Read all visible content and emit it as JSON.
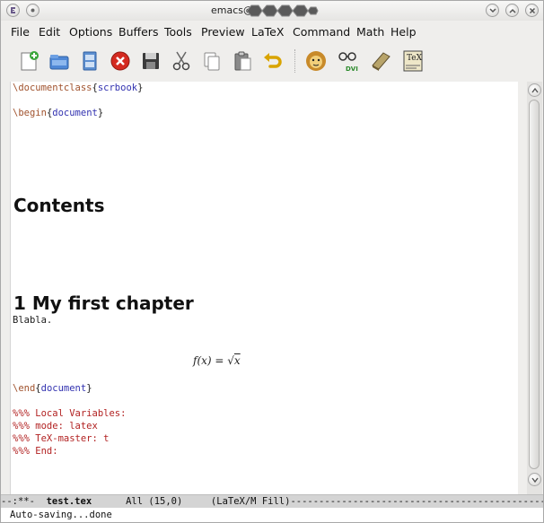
{
  "window": {
    "title": "emacs@"
  },
  "menu": [
    "File",
    "Edit",
    "Options",
    "Buffers",
    "Tools",
    "Preview",
    "LaTeX",
    "Command",
    "Math",
    "Help"
  ],
  "toolbar": {
    "dvi_label": "DVI",
    "tex_label": "TeX"
  },
  "buffer": {
    "line1": {
      "cmd": "\\documentclass",
      "open": "{",
      "arg": "scrbook",
      "close": "}"
    },
    "line2": {
      "cmd": "\\begin",
      "open": "{",
      "arg": "document",
      "close": "}"
    },
    "contents_heading": "Contents",
    "chapter_heading": "1  My first chapter",
    "body_text": "Blabla.",
    "math": {
      "lhs": "f(x) = ",
      "radical": "√",
      "rad_arg": "x"
    },
    "line_end": {
      "cmd": "\\end",
      "open": "{",
      "arg": "document",
      "close": "}"
    },
    "locals": [
      "%%% Local Variables:",
      "%%% mode: latex",
      "%%% TeX-master: t",
      "%%% End:"
    ]
  },
  "modeline": {
    "prefix": "--:**-  ",
    "buffer_name": "test.tex",
    "gap": "      ",
    "position": "All (15,0)",
    "gap2": "     ",
    "mode": "(LaTeX/M Fill)",
    "dashes": "--------------------------------------------------------------"
  },
  "echo": "Auto-saving...done"
}
